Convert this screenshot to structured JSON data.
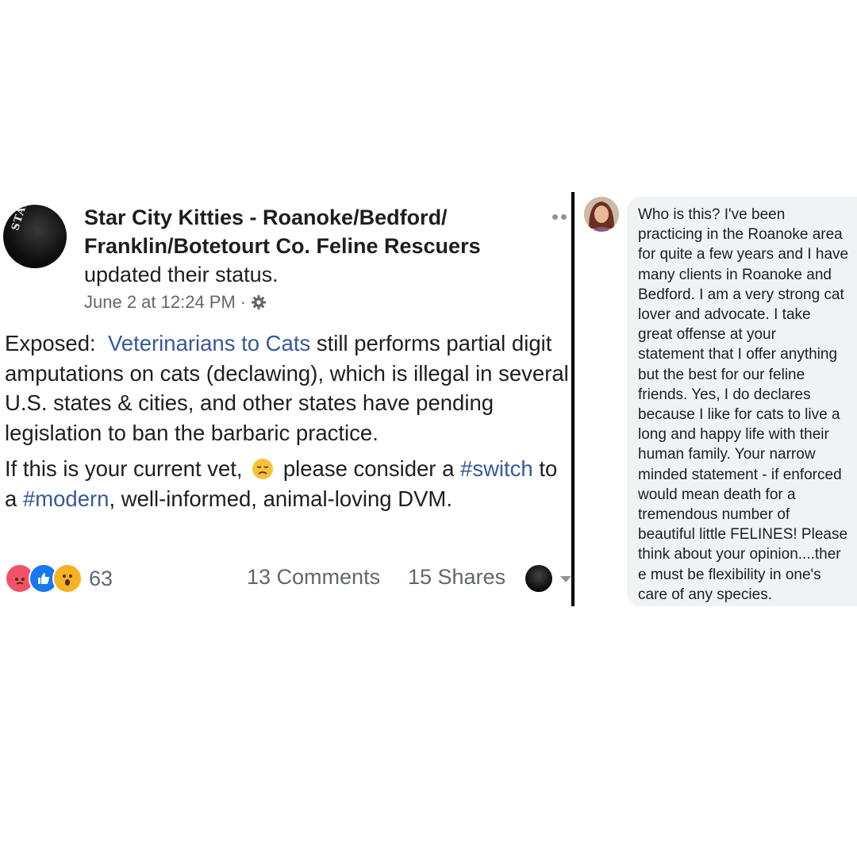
{
  "post": {
    "page_name": "Star City Kitties - Roanoke/Bedford/ Franklin/Botetourt Co. Feline Rescuers",
    "action": "updated their status.",
    "timestamp": "June 2 at 12:24 PM",
    "separator": "·",
    "privacy_icon": "gear-icon",
    "avatar_logo_text": "STAR CITY KITTIES",
    "body": {
      "p1_prefix": "Exposed:",
      "p1_link": "Veterinarians to Cats",
      "p1_suffix": "still performs partial digit amputations on cats (declawing), which is illegal in several U.S. states & cities, and other states have pending legislation to ban the barbaric practice.",
      "p2_prefix": "If this is your current vet,",
      "p2_emoji": "disappointed-face-emoji",
      "p2_mid": "please consider a",
      "p2_tag1": "#switch",
      "p2_mid2": "to a",
      "p2_tag2": "#modern",
      "p2_suffix": ", well-informed, animal-loving DVM."
    },
    "footer": {
      "reactions": [
        "angry",
        "like",
        "wow"
      ],
      "reaction_count": "63",
      "comments": "13 Comments",
      "shares": "15 Shares"
    }
  },
  "comment": {
    "text": "Who is this?  I've been\npracticing in the Roanoke area\nfor quite a few years and I have\nmany clients in Roanoke and\nBedford.  I am a very strong cat\nlover and advocate.  I take\ngreat offense at your\nstatement that I offer anything\nbut the best for our feline\nfriends.  Yes, I do declares\nbecause I like for cats to live a\nlong and happy life with their\nhuman family. Your narrow\nminded statement - if enforced\nwould mean death for a\ntremendous number of\nbeautiful little FELINES!  Please\nthink about your opinion....ther\ne must be flexibility in one's\ncare of any species."
  },
  "colors": {
    "link": "#385898",
    "meta": "#606770",
    "bubble": "#f0f2f5",
    "angry": "#f25268",
    "like": "#1877f2",
    "wow": "#f7b125"
  }
}
